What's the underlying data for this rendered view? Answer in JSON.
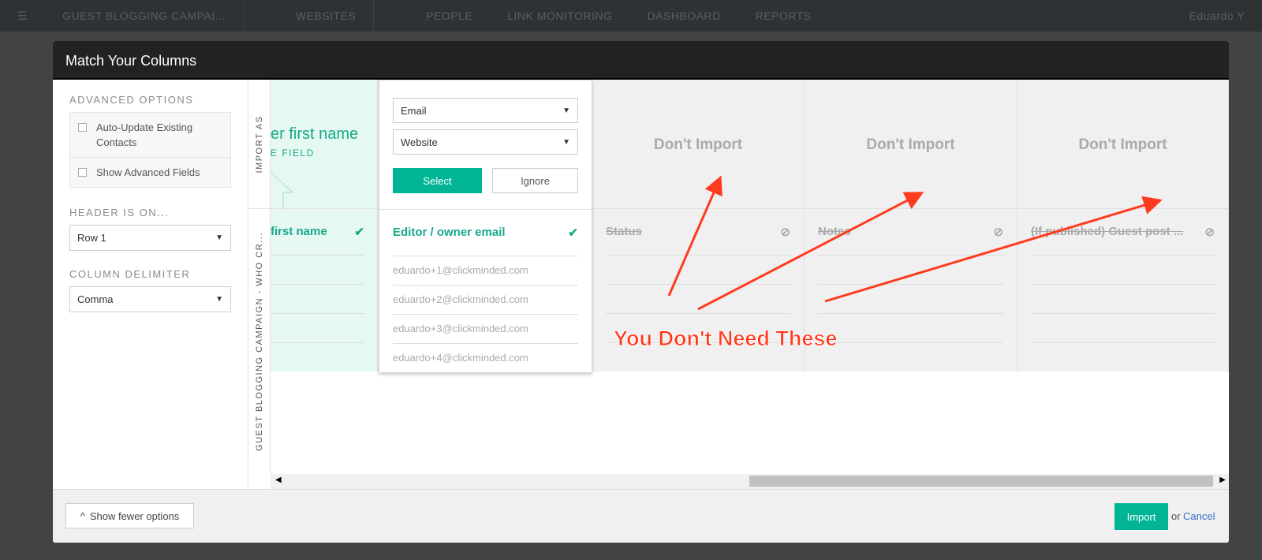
{
  "nav": {
    "campaign": "GUEST BLOGGING CAMPAI...",
    "items": [
      "WEBSITES",
      "PEOPLE",
      "LINK MONITORING",
      "DASHBOARD",
      "REPORTS"
    ],
    "user": "Eduardo Y"
  },
  "modal": {
    "title": "Match Your Columns"
  },
  "left": {
    "advanced_title": "ADVANCED OPTIONS",
    "options": [
      "Auto-Update Existing Contacts",
      "Show Advanced Fields"
    ],
    "header_title": "HEADER IS ON...",
    "header_value": "Row 1",
    "delim_title": "COLUMN DELIMITER",
    "delim_value": "Comma"
  },
  "grid": {
    "import_as": "IMPORT AS",
    "sheet_label": "GUEST BLOGGING CAMPAIGN - WHO CR...",
    "first_col": {
      "import": "er first name",
      "sub": "E FIELD",
      "header": "first name"
    },
    "popup": {
      "select1": "Email",
      "select2": "Website",
      "select_btn": "Select",
      "ignore_btn": "Ignore",
      "header": "Editor / owner email",
      "cells": [
        "eduardo+1@clickminded.com",
        "eduardo+2@clickminded.com",
        "eduardo+3@clickminded.com",
        "eduardo+4@clickminded.com"
      ]
    },
    "columns": [
      {
        "import": "Don't Import",
        "header": "Status"
      },
      {
        "import": "Don't Import",
        "header": "Notes"
      },
      {
        "import": "Don't Import",
        "header": "(If published) Guest post ..."
      }
    ]
  },
  "annotation": {
    "text": "You Don't Need These",
    "color": "#ff3b1f"
  },
  "footer": {
    "fewer": "Show fewer options",
    "import": "Import",
    "or": "or",
    "cancel": "Cancel"
  },
  "colors": {
    "accent": "#00b495",
    "link": "#3b6fc7"
  }
}
